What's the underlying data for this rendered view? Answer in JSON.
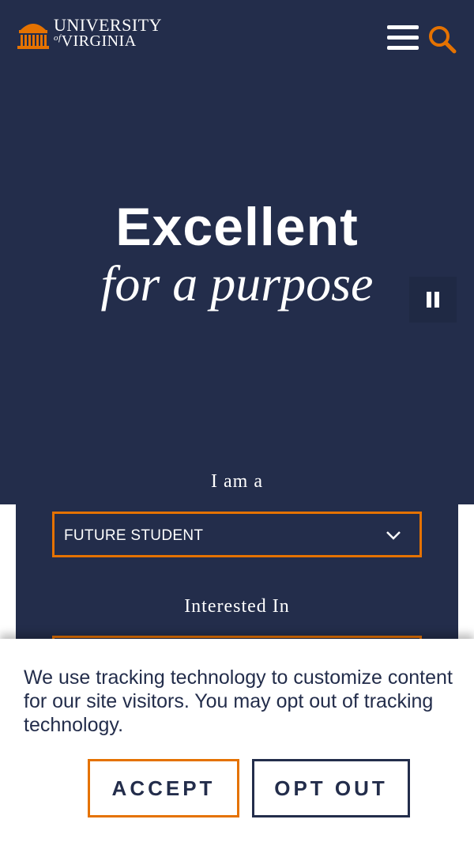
{
  "header": {
    "logo": {
      "line1": "UNIVERSITY",
      "of": "of",
      "line2": "VIRGINIA"
    },
    "menu_icon": "hamburger-menu-icon",
    "search_icon": "search-icon"
  },
  "hero": {
    "title": "Excellent",
    "subtitle": "for a purpose",
    "pause_icon": "pause-icon"
  },
  "finder": {
    "iam_label": "I am a",
    "iam_selected": "FUTURE STUDENT",
    "interest_label": "Interested In"
  },
  "cookie_banner": {
    "message": "We use tracking technology to customize content for our site visitors. You may opt out of tracking technology.",
    "accept_label": "ACCEPT",
    "optout_label": "OPT OUT"
  },
  "colors": {
    "navy": "#232D4B",
    "orange": "#E57200",
    "white": "#FFFFFF"
  }
}
